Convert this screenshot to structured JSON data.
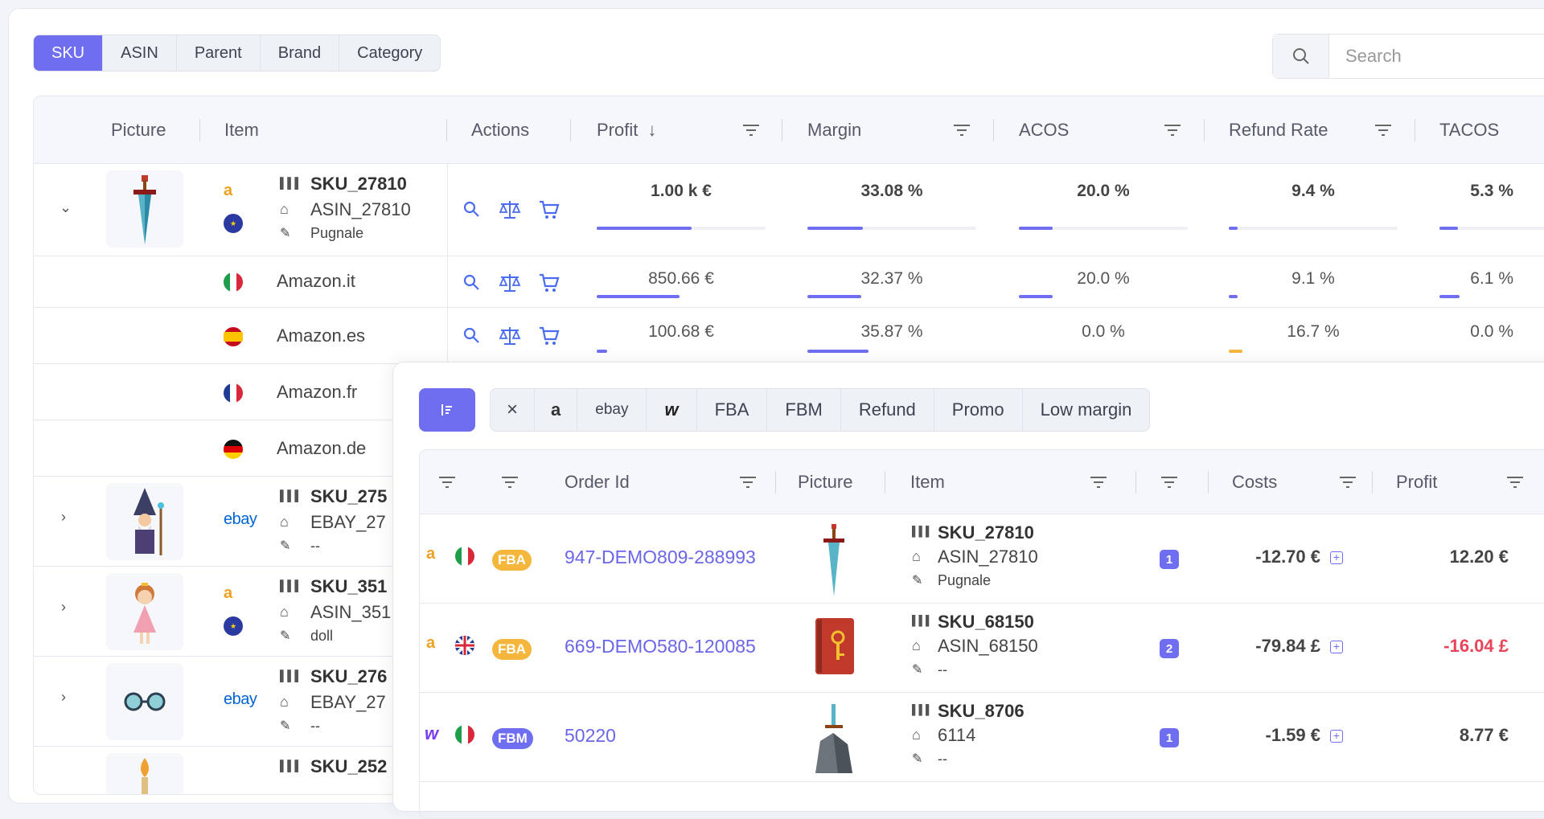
{
  "tabs": [
    "SKU",
    "ASIN",
    "Parent",
    "Brand",
    "Category"
  ],
  "search": {
    "placeholder": "Search"
  },
  "table1": {
    "headers": {
      "picture": "Picture",
      "item": "Item",
      "actions": "Actions",
      "profit": "Profit",
      "margin": "Margin",
      "acos": "ACOS",
      "refund": "Refund Rate",
      "tacos": "TACOS"
    },
    "main": {
      "sku": "SKU_27810",
      "asin": "ASIN_27810",
      "tag": "Pugnale",
      "profit": "1.00 k €",
      "margin": "33.08 %",
      "acos": "20.0 %",
      "refund": "9.4 %",
      "tacos": "5.3 %",
      "bars": {
        "profit": 0.56,
        "margin": 0.33,
        "acos": 0.2,
        "refund": 0.05,
        "tacos": 0.11
      }
    },
    "markets": [
      {
        "name": "Amazon.it",
        "profit": "850.66 €",
        "margin": "32.37 %",
        "acos": "20.0 %",
        "refund": "9.1 %",
        "tacos": "6.1 %",
        "bars": {
          "profit": 0.49,
          "margin": 0.32,
          "acos": 0.2,
          "refund": 0.05,
          "tacos": 0.12
        }
      },
      {
        "name": "Amazon.es",
        "profit": "100.68 €",
        "margin": "35.87 %",
        "acos": "0.0 %",
        "refund": "16.7 %",
        "tacos": "0.0 %",
        "bars": {
          "profit": 0.06,
          "margin": 0.36,
          "acos": 0.0,
          "refund": 0.08,
          "tacos": 0.0
        }
      },
      {
        "name": "Amazon.fr"
      },
      {
        "name": "Amazon.de"
      }
    ],
    "others": [
      {
        "sku": "SKU_275",
        "asin": "EBAY_27",
        "tag": "--"
      },
      {
        "sku": "SKU_351",
        "asin": "ASIN_351",
        "tag": "doll"
      },
      {
        "sku": "SKU_276",
        "asin": "EBAY_27",
        "tag": "--"
      },
      {
        "sku": "SKU_252",
        "asin": "",
        "tag": ""
      }
    ]
  },
  "filters": [
    "×",
    "amazon-logo",
    "ebay",
    "w",
    "FBA",
    "FBM",
    "Refund",
    "Promo",
    "Low margin"
  ],
  "filter_labels": {
    "ebay": "ebay",
    "w": "w",
    "fba": "FBA",
    "fbm": "FBM",
    "refund": "Refund",
    "promo": "Promo",
    "low": "Low margin",
    "close": "×"
  },
  "table2": {
    "headers": {
      "order": "Order Id",
      "picture": "Picture",
      "item": "Item",
      "costs": "Costs",
      "profit": "Profit"
    },
    "rows": [
      {
        "oid": "947-DEMO809-288993",
        "fulfil": "FBA",
        "sku": "SKU_27810",
        "asin": "ASIN_27810",
        "tag": "Pugnale",
        "qty": "1",
        "cost": "-12.70 €",
        "profit": "12.20 €"
      },
      {
        "oid": "669-DEMO580-120085",
        "fulfil": "FBA",
        "sku": "SKU_68150",
        "asin": "ASIN_68150",
        "tag": "--",
        "qty": "2",
        "cost": "-79.84 £",
        "profit": "-16.04 £"
      },
      {
        "oid": "50220",
        "fulfil": "FBM",
        "sku": "SKU_8706",
        "asin": "6114",
        "tag": "--",
        "qty": "1",
        "cost": "-1.59 €",
        "profit": "8.77 €"
      }
    ]
  },
  "colors": {
    "accent": "#6f6ef0",
    "negative": "#e8455a",
    "amazon": "#f0a020",
    "ebay": "#0064d2",
    "fba": "#f5b63c"
  }
}
